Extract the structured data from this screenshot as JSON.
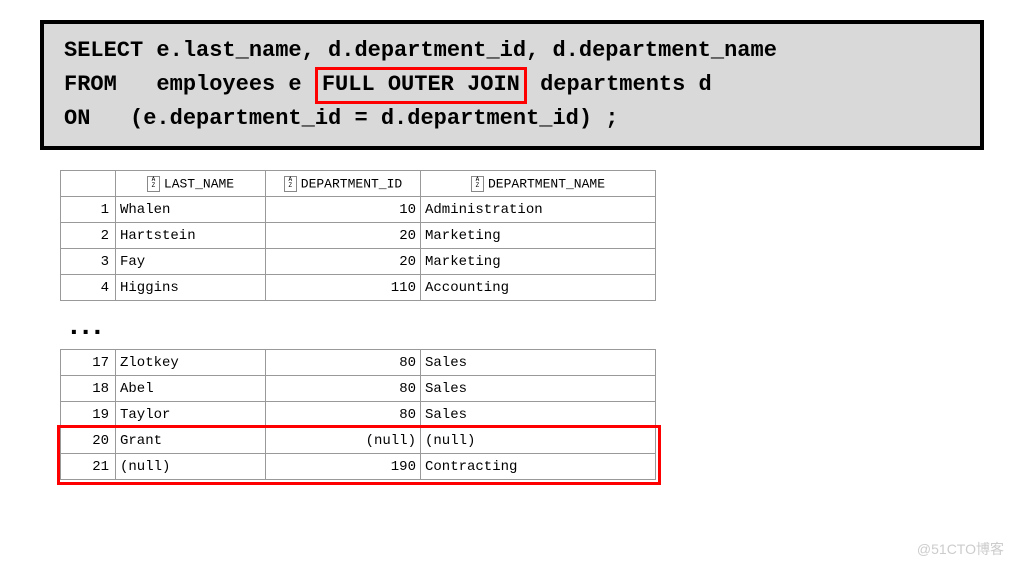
{
  "sql": {
    "line1a": "SELECT e.last_name, d.department_id, d.department_name",
    "line2a": "FROM   employees e ",
    "line2highlight": "FULL OUTER JOIN",
    "line2b": " departments d",
    "line3": "ON   (e.department_id = d.department_id) ;"
  },
  "headers": {
    "col1": "LAST_NAME",
    "col2": "DEPARTMENT_ID",
    "col3": "DEPARTMENT_NAME"
  },
  "table1": [
    {
      "num": "1",
      "last_name": "Whalen",
      "dept_id": "10",
      "dept_name": "Administration"
    },
    {
      "num": "2",
      "last_name": "Hartstein",
      "dept_id": "20",
      "dept_name": "Marketing"
    },
    {
      "num": "3",
      "last_name": "Fay",
      "dept_id": "20",
      "dept_name": "Marketing"
    },
    {
      "num": "4",
      "last_name": "Higgins",
      "dept_id": "110",
      "dept_name": "Accounting"
    }
  ],
  "ellipsis": "...",
  "table2": [
    {
      "num": "17",
      "last_name": "Zlotkey",
      "dept_id": "80",
      "dept_name": "Sales"
    },
    {
      "num": "18",
      "last_name": "Abel",
      "dept_id": "80",
      "dept_name": "Sales"
    },
    {
      "num": "19",
      "last_name": "Taylor",
      "dept_id": "80",
      "dept_name": "Sales"
    },
    {
      "num": "20",
      "last_name": "Grant",
      "dept_id": "(null)",
      "dept_name": "(null)"
    },
    {
      "num": "21",
      "last_name": "(null)",
      "dept_id": "190",
      "dept_name": "Contracting"
    }
  ],
  "watermark": "@51CTO博客"
}
